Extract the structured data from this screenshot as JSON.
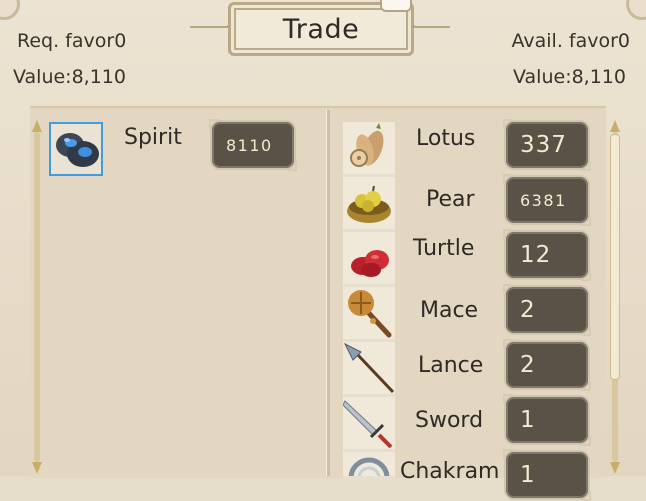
{
  "title": "Trade",
  "notification_glyph": "...",
  "left_header": {
    "favor": "Req. favor0",
    "value": "Value:8,110"
  },
  "right_header": {
    "favor": "Avail. favor0",
    "value": "Value:8,110"
  },
  "offered": [
    {
      "name": "Spirit",
      "count": "8110",
      "icon": "spirit-stones-icon"
    }
  ],
  "inventory": [
    {
      "name": "Lotus",
      "count": "337",
      "icon": "lotus-root-icon"
    },
    {
      "name": "Pear",
      "count": "6381",
      "icon": "pear-basket-icon"
    },
    {
      "name": "Turtle",
      "count": "12",
      "icon": "turtle-meat-icon"
    },
    {
      "name": "Mace",
      "count": "2",
      "icon": "mace-icon"
    },
    {
      "name": "Lance",
      "count": "2",
      "icon": "lance-icon"
    },
    {
      "name": "Sword",
      "count": "1",
      "icon": "sword-icon"
    },
    {
      "name": "Chakram",
      "count": "1",
      "icon": "chakram-icon"
    }
  ]
}
